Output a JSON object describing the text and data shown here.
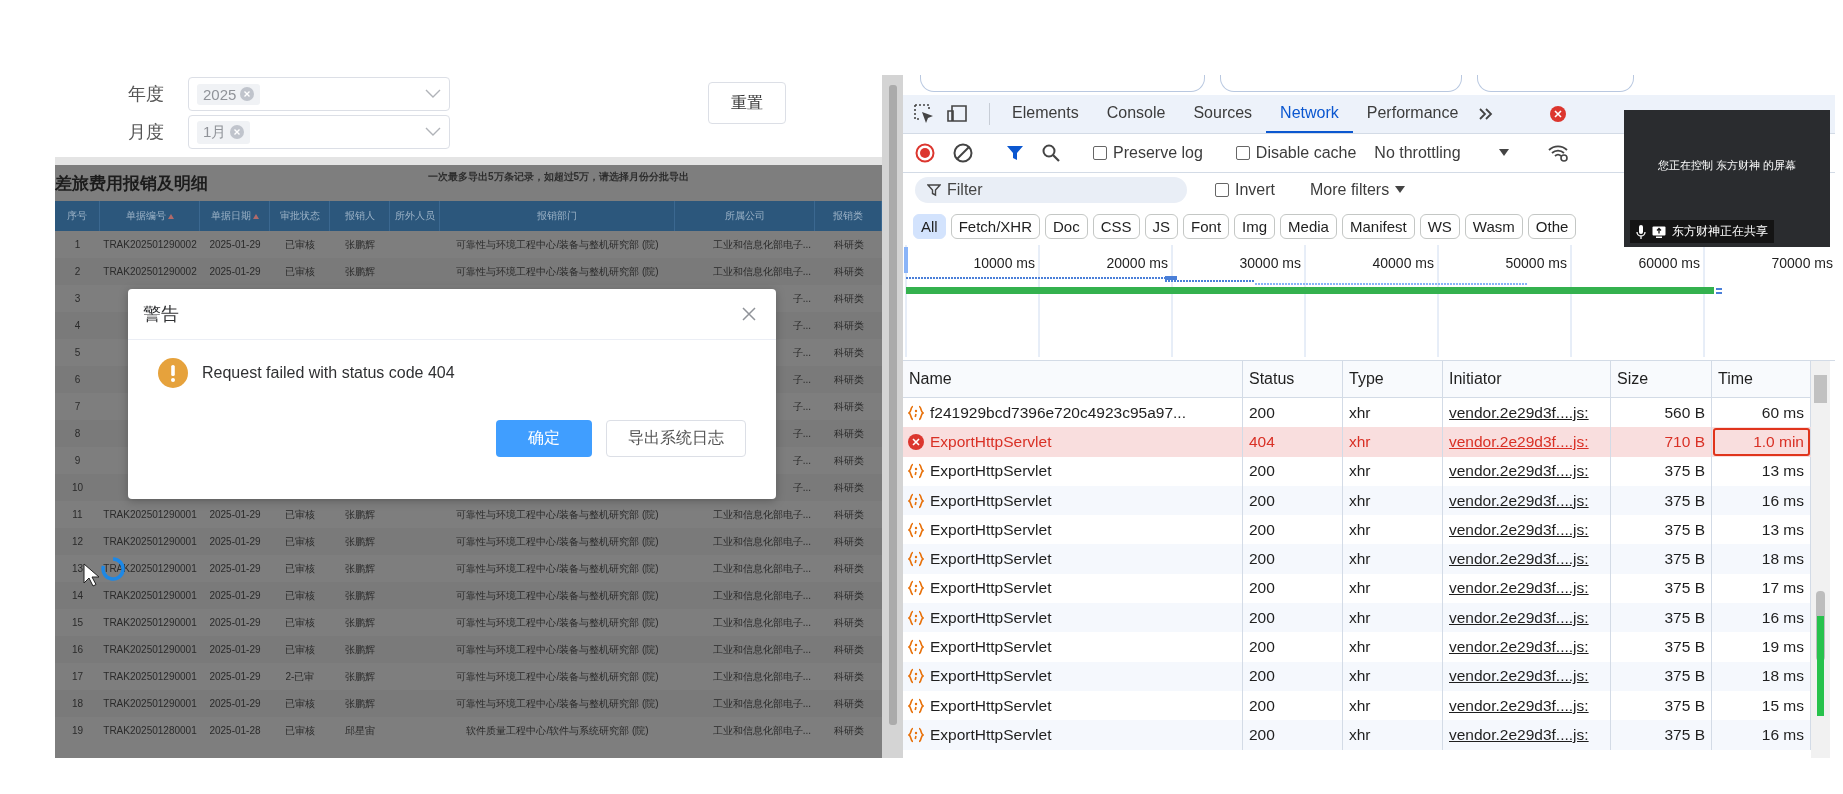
{
  "filters": [
    {
      "label": "年度",
      "tag": "2025"
    },
    {
      "label": "月度",
      "tag": "1月"
    }
  ],
  "reset_button": "重置",
  "report": {
    "title": "差旅费用报销及明细",
    "note": "一次最多导出5万条记录，如超过5万，请选择月份分批导出",
    "columns": [
      {
        "label": "序号",
        "sortable": false
      },
      {
        "label": "单据编号",
        "sortable": true
      },
      {
        "label": "单据日期",
        "sortable": true
      },
      {
        "label": "审批状态",
        "sortable": false
      },
      {
        "label": "报销人",
        "sortable": false
      },
      {
        "label": "所外人员",
        "sortable": false
      },
      {
        "label": "报销部门",
        "sortable": false
      },
      {
        "label": "所属公司",
        "sortable": false
      },
      {
        "label": "报销类",
        "sortable": false
      }
    ],
    "rows": [
      {
        "index": "1",
        "number": "TRAK202501290002",
        "date": "2025-01-29",
        "status": "已审核",
        "person": "张鹏辉",
        "department": "可靠性与环境工程中心/装备与整机研究部 (院)",
        "company": "工业和信息化部电子...",
        "type": "科研类"
      },
      {
        "index": "2",
        "number": "TRAK202501290002",
        "date": "2025-01-29",
        "status": "已审核",
        "person": "张鹏辉",
        "department": "可靠性与环境工程中心/装备与整机研究部 (院)",
        "company": "工业和信息化部电子...",
        "type": "科研类"
      },
      {
        "index": "3",
        "company": "子...",
        "type": "科研类"
      },
      {
        "index": "4",
        "company": "子...",
        "type": "科研类"
      },
      {
        "index": "5",
        "company": "子...",
        "type": "科研类"
      },
      {
        "index": "6",
        "company": "子...",
        "type": "科研类"
      },
      {
        "index": "7",
        "company": "子...",
        "type": "科研类"
      },
      {
        "index": "8",
        "company": "子...",
        "type": "科研类"
      },
      {
        "index": "9",
        "company": "子...",
        "type": "科研类"
      },
      {
        "index": "10",
        "company": "子...",
        "type": "科研类"
      },
      {
        "index": "11",
        "number": "TRAK202501290001",
        "date": "2025-01-29",
        "status": "已审核",
        "person": "张鹏辉",
        "department": "可靠性与环境工程中心/装备与整机研究部 (院)",
        "company": "工业和信息化部电子...",
        "type": "科研类"
      },
      {
        "index": "12",
        "number": "TRAK202501290001",
        "date": "2025-01-29",
        "status": "已审核",
        "person": "张鹏辉",
        "department": "可靠性与环境工程中心/装备与整机研究部 (院)",
        "company": "工业和信息化部电子...",
        "type": "科研类"
      },
      {
        "index": "13",
        "number": "TRAK202501290001",
        "date": "2025-01-29",
        "status": "已审核",
        "person": "张鹏辉",
        "department": "可靠性与环境工程中心/装备与整机研究部 (院)",
        "company": "工业和信息化部电子...",
        "type": "科研类"
      },
      {
        "index": "14",
        "number": "TRAK202501290001",
        "date": "2025-01-29",
        "status": "已审核",
        "person": "张鹏辉",
        "department": "可靠性与环境工程中心/装备与整机研究部 (院)",
        "company": "工业和信息化部电子...",
        "type": "科研类"
      },
      {
        "index": "15",
        "number": "TRAK202501290001",
        "date": "2025-01-29",
        "status": "已审核",
        "person": "张鹏辉",
        "department": "可靠性与环境工程中心/装备与整机研究部 (院)",
        "company": "工业和信息化部电子...",
        "type": "科研类"
      },
      {
        "index": "16",
        "number": "TRAK202501290001",
        "date": "2025-01-29",
        "status": "已审核",
        "person": "张鹏辉",
        "department": "可靠性与环境工程中心/装备与整机研究部 (院)",
        "company": "工业和信息化部电子...",
        "type": "科研类"
      },
      {
        "index": "17",
        "number": "TRAK202501290001",
        "date": "2025-01-29",
        "status": "2-已审",
        "person": "张鹏辉",
        "department": "可靠性与环境工程中心/装备与整机研究部 (院)",
        "company": "工业和信息化部电子...",
        "type": "科研类"
      },
      {
        "index": "18",
        "number": "TRAK202501290001",
        "date": "2025-01-29",
        "status": "已审核",
        "person": "张鹏辉",
        "department": "可靠性与环境工程中心/装备与整机研究部 (院)",
        "company": "工业和信息化部电子...",
        "type": "科研类"
      },
      {
        "index": "19",
        "number": "TRAK202501280001",
        "date": "2025-01-28",
        "status": "已审核",
        "person": "邱星宙",
        "department": "软件质量工程中心/软件与系统研究部 (院)",
        "company": "工业和信息化部电子...",
        "type": "科研类"
      }
    ]
  },
  "dialog": {
    "title": "警告",
    "message": "Request failed with status code 404",
    "buttons": [
      {
        "label": "确定",
        "kind": "primary"
      },
      {
        "label": "导出系统日志",
        "kind": "secondary"
      }
    ]
  },
  "devtools": {
    "tabs": [
      {
        "label": "Elements",
        "selected": false
      },
      {
        "label": "Console",
        "selected": false
      },
      {
        "label": "Sources",
        "selected": false
      },
      {
        "label": "Network",
        "selected": true
      },
      {
        "label": "Performance",
        "selected": false
      }
    ],
    "toolbar": {
      "checkboxes": [
        {
          "label": "Preserve log",
          "checked": false
        },
        {
          "label": "Disable cache",
          "checked": false
        }
      ],
      "throttling": "No throttling"
    },
    "filter": {
      "placeholder": "Filter",
      "invert": {
        "label": "Invert",
        "checked": false
      },
      "more_filters": "More filters"
    },
    "type_filters": [
      {
        "label": "All",
        "selected": true
      },
      {
        "label": "Fetch/XHR",
        "selected": false
      },
      {
        "label": "Doc",
        "selected": false
      },
      {
        "label": "CSS",
        "selected": false
      },
      {
        "label": "JS",
        "selected": false
      },
      {
        "label": "Font",
        "selected": false
      },
      {
        "label": "Img",
        "selected": false
      },
      {
        "label": "Media",
        "selected": false
      },
      {
        "label": "Manifest",
        "selected": false
      },
      {
        "label": "WS",
        "selected": false
      },
      {
        "label": "Wasm",
        "selected": false
      },
      {
        "label": "Othe",
        "selected": false
      }
    ],
    "timeline_ticks": [
      "10000 ms",
      "20000 ms",
      "30000 ms",
      "40000 ms",
      "50000 ms",
      "60000 ms",
      "70000 ms"
    ],
    "columns": [
      "Name",
      "Status",
      "Type",
      "Initiator",
      "Size",
      "Time"
    ],
    "requests": [
      {
        "name": "f241929bcd7396e720c4923c95a97...",
        "status": "200",
        "type": "xhr",
        "initiator": "vendor.2e29d3f....js:",
        "size": "560 B",
        "time": "60 ms",
        "failed": false,
        "marked": false
      },
      {
        "name": "ExportHttpServlet",
        "status": "404",
        "type": "xhr",
        "initiator": "vendor.2e29d3f....js:",
        "size": "710 B",
        "time": "1.0 min",
        "failed": true,
        "marked": true
      },
      {
        "name": "ExportHttpServlet",
        "status": "200",
        "type": "xhr",
        "initiator": "vendor.2e29d3f....js:",
        "size": "375 B",
        "time": "13 ms",
        "failed": false,
        "marked": false
      },
      {
        "name": "ExportHttpServlet",
        "status": "200",
        "type": "xhr",
        "initiator": "vendor.2e29d3f....js:",
        "size": "375 B",
        "time": "16 ms",
        "failed": false,
        "marked": false
      },
      {
        "name": "ExportHttpServlet",
        "status": "200",
        "type": "xhr",
        "initiator": "vendor.2e29d3f....js:",
        "size": "375 B",
        "time": "13 ms",
        "failed": false,
        "marked": false
      },
      {
        "name": "ExportHttpServlet",
        "status": "200",
        "type": "xhr",
        "initiator": "vendor.2e29d3f....js:",
        "size": "375 B",
        "time": "18 ms",
        "failed": false,
        "marked": false
      },
      {
        "name": "ExportHttpServlet",
        "status": "200",
        "type": "xhr",
        "initiator": "vendor.2e29d3f....js:",
        "size": "375 B",
        "time": "17 ms",
        "failed": false,
        "marked": false
      },
      {
        "name": "ExportHttpServlet",
        "status": "200",
        "type": "xhr",
        "initiator": "vendor.2e29d3f....js:",
        "size": "375 B",
        "time": "16 ms",
        "failed": false,
        "marked": false
      },
      {
        "name": "ExportHttpServlet",
        "status": "200",
        "type": "xhr",
        "initiator": "vendor.2e29d3f....js:",
        "size": "375 B",
        "time": "19 ms",
        "failed": false,
        "marked": false
      },
      {
        "name": "ExportHttpServlet",
        "status": "200",
        "type": "xhr",
        "initiator": "vendor.2e29d3f....js:",
        "size": "375 B",
        "time": "18 ms",
        "failed": false,
        "marked": false
      },
      {
        "name": "ExportHttpServlet",
        "status": "200",
        "type": "xhr",
        "initiator": "vendor.2e29d3f....js:",
        "size": "375 B",
        "time": "15 ms",
        "failed": false,
        "marked": false
      },
      {
        "name": "ExportHttpServlet",
        "status": "200",
        "type": "xhr",
        "initiator": "vendor.2e29d3f....js:",
        "size": "375 B",
        "time": "16 ms",
        "failed": false,
        "marked": false
      }
    ]
  },
  "screen_share": {
    "message": "您正在控制 东方财神 的屏幕",
    "sharing": "东方财神正在共享"
  }
}
